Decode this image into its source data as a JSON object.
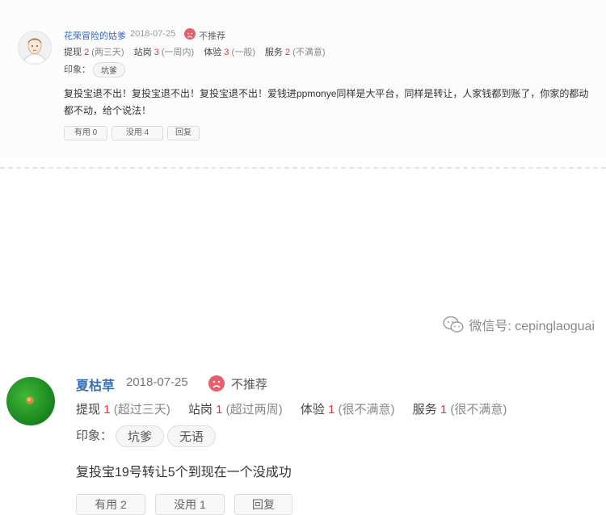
{
  "reviews": [
    {
      "username": "花荣冒险的姑爹",
      "date": "2018-07-25",
      "verdict": "不推荐",
      "ratings": [
        {
          "label": "提现",
          "score": "2",
          "desc": "(两三天)"
        },
        {
          "label": "站岗",
          "score": "3",
          "desc": "(一周内)"
        },
        {
          "label": "体验",
          "score": "3",
          "desc": "(一般)"
        },
        {
          "label": "服务",
          "score": "2",
          "desc": "(不满意)"
        }
      ],
      "tags_label": "印象：",
      "tags": [
        "坑爹"
      ],
      "content": "复投宝退不出！复投宝退不出！复投宝退不出！爱钱进ppmonye同样是大平台，同样是转让，人家钱都到账了，你家的都动都不动，给个说法！",
      "actions": {
        "helpful": "有用 0",
        "useless": "没用 4",
        "reply": "回复"
      }
    },
    {
      "username": "夏枯草",
      "date": "2018-07-25",
      "verdict": "不推荐",
      "ratings": [
        {
          "label": "提现",
          "score": "1",
          "desc": "(超过三天)"
        },
        {
          "label": "站岗",
          "score": "1",
          "desc": "(超过两周)"
        },
        {
          "label": "体验",
          "score": "1",
          "desc": "(很不满意)"
        },
        {
          "label": "服务",
          "score": "1",
          "desc": "(很不满意)"
        }
      ],
      "tags_label": "印象：",
      "tags": [
        "坑爹",
        "无语"
      ],
      "content": "复投宝19号转让5个到现在一个没成功",
      "actions": {
        "helpful": "有用 2",
        "useless": "没用 1",
        "reply": "回复"
      }
    }
  ],
  "watermark": "微信号: cepinglaoguai",
  "colors": {
    "username": "#3366cc",
    "score": "#e2343d",
    "sad_face": "#e85d6a"
  }
}
